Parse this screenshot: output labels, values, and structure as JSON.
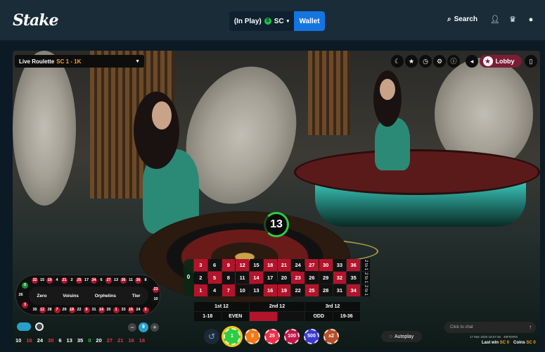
{
  "header": {
    "logo": "Stake",
    "balance_label": "(In Play)",
    "currency": "SC",
    "currency_icon": "S",
    "wallet_label": "Wallet",
    "search_label": "Search",
    "user_icon": "user-icon",
    "rewards_icon": "rewards-icon",
    "chat_icon": "chat-icon"
  },
  "game": {
    "title": "Live Roulette",
    "limits": "SC 1 - 1K",
    "lobby_label": "Lobby",
    "timer": "13",
    "controls": [
      "moon-icon",
      "star-icon",
      "clock-icon",
      "settings-icon",
      "info-icon",
      "volume-icon"
    ]
  },
  "board": {
    "zero": "0",
    "rows": [
      [
        {
          "n": "3",
          "c": "red"
        },
        {
          "n": "6",
          "c": "black"
        },
        {
          "n": "9",
          "c": "red"
        },
        {
          "n": "12",
          "c": "red"
        },
        {
          "n": "15",
          "c": "black"
        },
        {
          "n": "18",
          "c": "red"
        },
        {
          "n": "21",
          "c": "red"
        },
        {
          "n": "24",
          "c": "black"
        },
        {
          "n": "27",
          "c": "red"
        },
        {
          "n": "30",
          "c": "red"
        },
        {
          "n": "33",
          "c": "black"
        },
        {
          "n": "36",
          "c": "red"
        }
      ],
      [
        {
          "n": "2",
          "c": "black"
        },
        {
          "n": "5",
          "c": "red"
        },
        {
          "n": "8",
          "c": "black"
        },
        {
          "n": "11",
          "c": "black"
        },
        {
          "n": "14",
          "c": "red"
        },
        {
          "n": "17",
          "c": "black"
        },
        {
          "n": "20",
          "c": "black"
        },
        {
          "n": "23",
          "c": "red"
        },
        {
          "n": "26",
          "c": "black"
        },
        {
          "n": "29",
          "c": "black"
        },
        {
          "n": "32",
          "c": "red"
        },
        {
          "n": "35",
          "c": "black"
        }
      ],
      [
        {
          "n": "1",
          "c": "red"
        },
        {
          "n": "4",
          "c": "black"
        },
        {
          "n": "7",
          "c": "red"
        },
        {
          "n": "10",
          "c": "black"
        },
        {
          "n": "13",
          "c": "black"
        },
        {
          "n": "16",
          "c": "red"
        },
        {
          "n": "19",
          "c": "red"
        },
        {
          "n": "22",
          "c": "black"
        },
        {
          "n": "25",
          "c": "red"
        },
        {
          "n": "28",
          "c": "black"
        },
        {
          "n": "31",
          "c": "black"
        },
        {
          "n": "34",
          "c": "red"
        }
      ]
    ],
    "column_label": "2 to 1",
    "dozens": [
      "1st 12",
      "2nd 12",
      "3rd 12"
    ],
    "even_money": [
      "1-18",
      "EVEN",
      "",
      "",
      "ODD",
      "19-36"
    ]
  },
  "racetrack": {
    "sections": [
      "Zero",
      "Voisins",
      "Orphelins",
      "Tier"
    ],
    "top": [
      "32",
      "15",
      "19",
      "4",
      "21",
      "2",
      "25",
      "17",
      "34",
      "6",
      "27",
      "13",
      "36",
      "11",
      "30",
      "8"
    ],
    "bottom": [
      "35",
      "12",
      "28",
      "7",
      "29",
      "18",
      "22",
      "9",
      "31",
      "14",
      "20",
      "1",
      "33",
      "16",
      "24",
      "5"
    ],
    "left": [
      "0",
      "26",
      "3"
    ],
    "right": [
      "23",
      "10"
    ]
  },
  "stepper": {
    "value": "9",
    "minus": "−",
    "plus": "+"
  },
  "history": [
    {
      "n": "10",
      "c": "w"
    },
    {
      "n": "16",
      "c": "r"
    },
    {
      "n": "24",
      "c": "w"
    },
    {
      "n": "30",
      "c": "r"
    },
    {
      "n": "6",
      "c": "w"
    },
    {
      "n": "13",
      "c": "w"
    },
    {
      "n": "35",
      "c": "w"
    },
    {
      "n": "0",
      "c": "g"
    },
    {
      "n": "20",
      "c": "w"
    },
    {
      "n": "27",
      "c": "r"
    },
    {
      "n": "21",
      "c": "r"
    },
    {
      "n": "16",
      "c": "r"
    },
    {
      "n": "16",
      "c": "r"
    }
  ],
  "chips": [
    {
      "label": "1",
      "color": "#2ecc40",
      "selected": true
    },
    {
      "label": "5",
      "color": "#f07a1a",
      "selected": false
    },
    {
      "label": "25",
      "color": "#e8324a",
      "selected": false
    },
    {
      "label": "100",
      "color": "#c0184a",
      "selected": false
    },
    {
      "label": "500",
      "color": "#3b3bd0",
      "selected": false
    },
    {
      "label": "x2",
      "color": "#b5502a",
      "selected": false
    }
  ],
  "autoplay_label": "Autoplay",
  "chat_placeholder": "Click to chat",
  "stat_line": "17 Mar 2025 18:57:45 · 48FNXRS",
  "footer": {
    "last_win_label": "Last win",
    "last_win_value": "SC 0",
    "coins_label": "Coins",
    "coins_value": "SC 0"
  },
  "colors": {
    "accent": "#1475e1",
    "red": "#b3142c",
    "green": "#2ecc40",
    "lobby": "#7a1d35"
  }
}
